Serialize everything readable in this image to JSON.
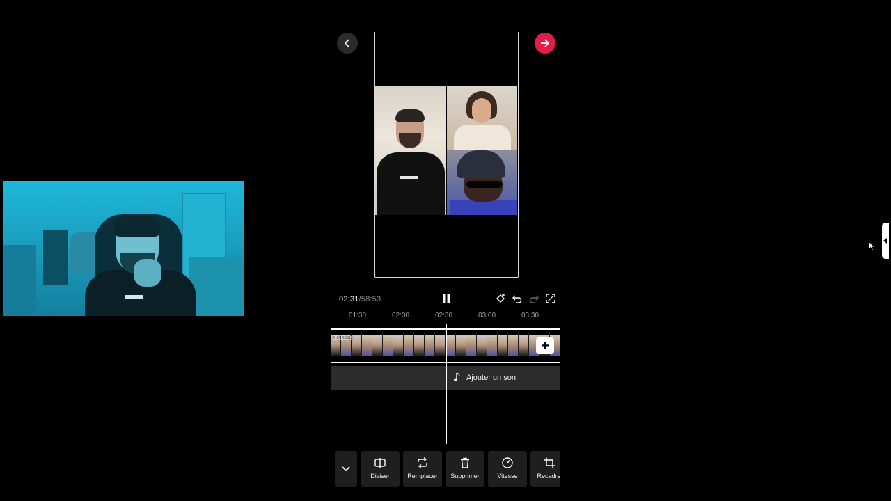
{
  "navigation": {
    "back_icon": "chevron-left-icon",
    "next_icon": "arrow-right-icon",
    "next_color": "#e11d48"
  },
  "playback": {
    "current_time": "02:31",
    "separator": "/",
    "total_time": "58:53",
    "pause_icon": "pause-icon",
    "tools": [
      "keyframe-icon",
      "undo-icon",
      "redo-icon",
      "fullscreen-icon"
    ]
  },
  "ruler": {
    "ticks": [
      "01:30",
      "02:00",
      "02:30",
      "03:00",
      "03:30"
    ]
  },
  "timeline": {
    "clip_duration": "3533.5s",
    "add_clip_label": "+",
    "add_sound_label": "Ajouter un son"
  },
  "toolbar": {
    "collapse_icon": "chevron-down-icon",
    "buttons": [
      {
        "label": "Diviser",
        "icon": "split-icon"
      },
      {
        "label": "Remplacer",
        "icon": "replace-icon"
      },
      {
        "label": "Supprimer",
        "icon": "trash-icon"
      },
      {
        "label": "Vitesse",
        "icon": "speed-icon"
      },
      {
        "label": "Recadrer",
        "icon": "crop-icon"
      }
    ]
  }
}
